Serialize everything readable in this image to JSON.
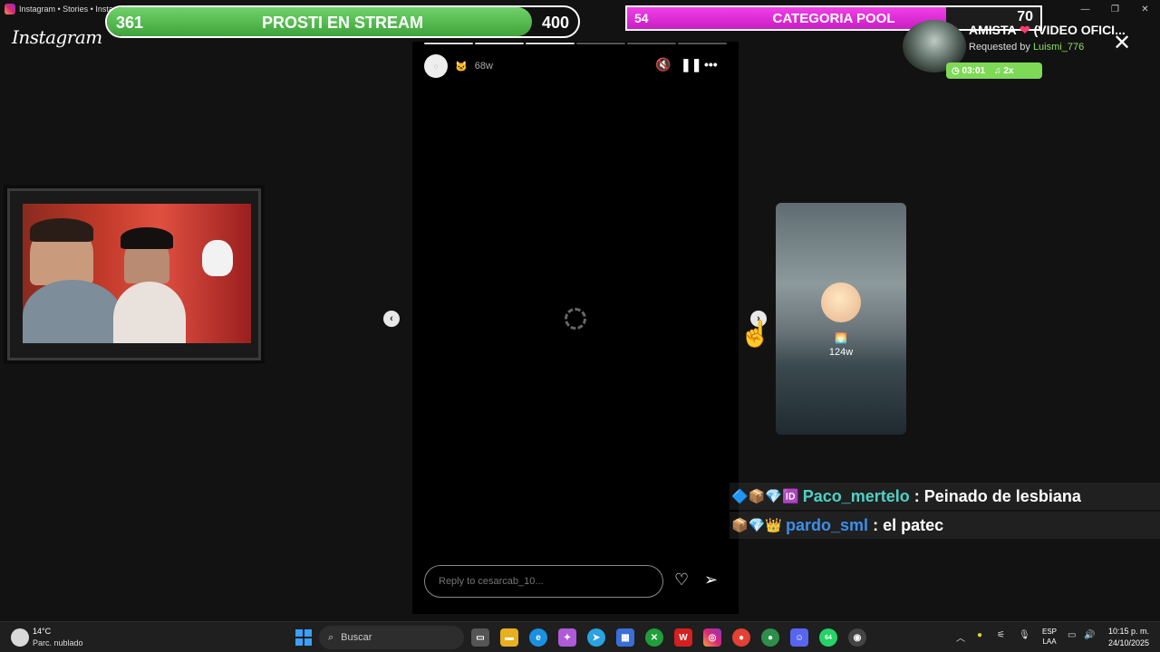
{
  "window": {
    "tab_title": "Instagram • Stories • Instagr",
    "min": "—",
    "max": "❐",
    "close": "✕"
  },
  "app": {
    "logo": "Instagram"
  },
  "overlay": {
    "goal1": {
      "left": "361",
      "label": "PROSTI EN STREAM",
      "right": "400",
      "progress": 0.9025,
      "color": "#4cbb47"
    },
    "goal2": {
      "left": "54",
      "label": "CATEGORIA POOL",
      "right": "70",
      "progress": 0.771,
      "color": "#e62be0"
    }
  },
  "song": {
    "title": "AMISTA",
    "title_suffix": "(VIDEO OFICI...",
    "requested_prefix": "Requested by ",
    "requested_user": "Luismi_776",
    "duration": "03:01",
    "multiplier": "2x"
  },
  "story": {
    "time_ago": "68w",
    "progress_segments": 6,
    "reply_placeholder": "Reply to cesarcab_10...",
    "next_preview_age": "124w"
  },
  "chat": [
    {
      "user": "Paco_mertelo",
      "separator": " : ",
      "message": "Peinado de lesbiana",
      "color": "#4fd1c5"
    },
    {
      "user": "pardo_sml",
      "separator": " : ",
      "message": "el patec",
      "color": "#3d8fe8"
    }
  ],
  "taskbar": {
    "weather_temp": "14°C",
    "weather_desc": "Parc. nublado",
    "search_placeholder": "Buscar",
    "lang_line1": "ESP",
    "lang_line2": "LAA",
    "time": "10:15 p. m.",
    "date": "24/10/2025",
    "whatsapp_badge": "64"
  },
  "icons": {
    "mute": "mute-icon",
    "pause": "pause-icon",
    "more": "more-icon",
    "heart": "heart-icon",
    "send": "send-icon",
    "prev": "chevron-left-icon",
    "next": "chevron-right-icon"
  }
}
